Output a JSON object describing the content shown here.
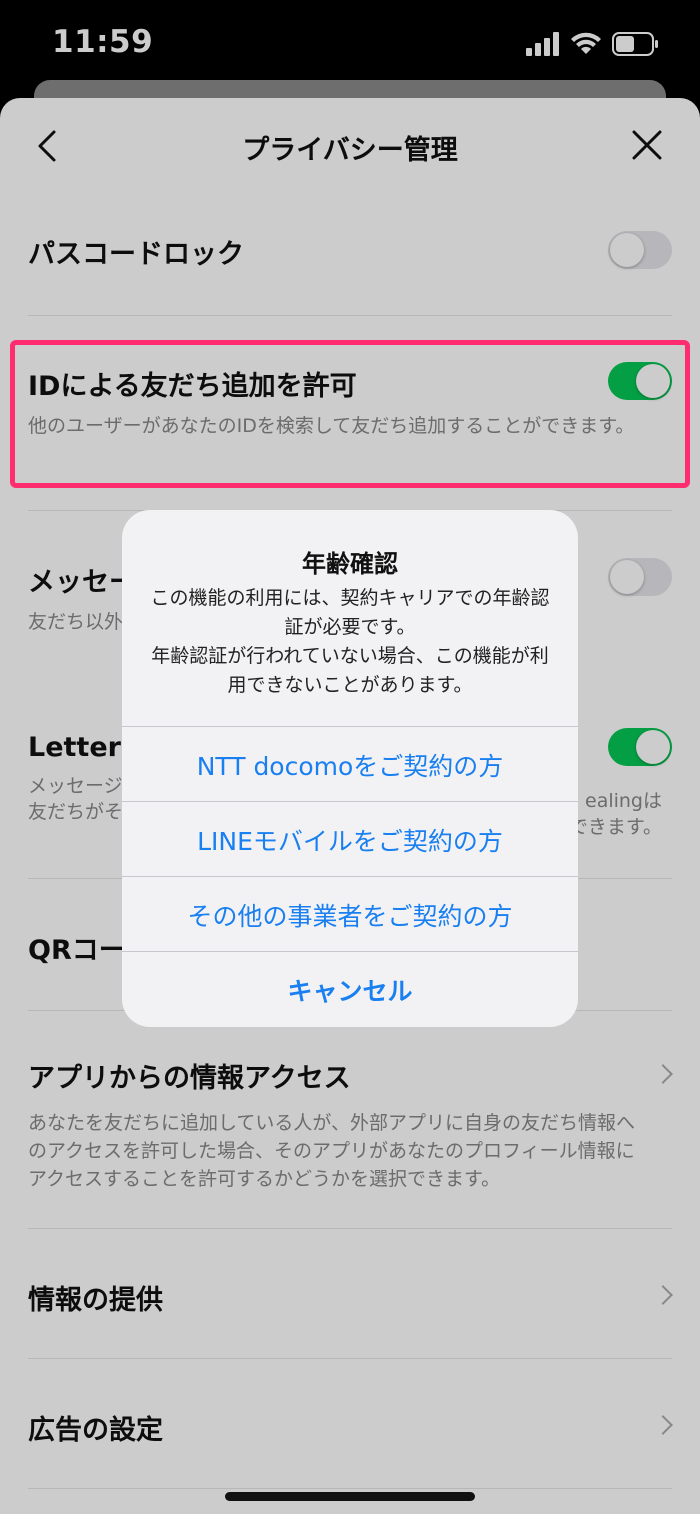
{
  "status": {
    "time": "11:59"
  },
  "nav": {
    "title": "プライバシー管理"
  },
  "settings": {
    "passcode": {
      "label": "パスコードロック",
      "enabled": false
    },
    "add_by_id": {
      "label": "IDによる友だち追加を許可",
      "desc": "他のユーザーがあなたのIDを検索して友だち追加することができます。",
      "enabled": true
    },
    "message_filter": {
      "label_visible": "メッセー",
      "desc_visible": "友だち以外",
      "enabled": false
    },
    "letter_sealing": {
      "label_visible": "Letter S",
      "desc_line1_left": "メッセージ",
      "desc_line1_right": "ealingは",
      "desc_line2_left": "友だちがそ",
      "desc_line2_right": "できます。",
      "enabled": true
    },
    "qr_code": {
      "label_visible": "QRコー"
    },
    "app_access": {
      "label": "アプリからの情報アクセス",
      "desc": "あなたを友だちに追加している人が、外部アプリに自身の友だち情報へのアクセスを許可した場合、そのアプリがあなたのプロフィール情報にアクセスすることを許可するかどうかを選択できます。"
    },
    "info_provision": {
      "label": "情報の提供"
    },
    "ad_settings": {
      "label": "広告の設定"
    }
  },
  "alert": {
    "title": "年齢確認",
    "message": "この機能の利用には、契約キャリアでの年齢認証が必要です。\n年齢認証が行われていない場合、この機能が利用できないことがあります。",
    "buttons": {
      "docomo": "NTT docomoをご契約の方",
      "line_mobile": "LINEモバイルをご契約の方",
      "other": "その他の事業者をご契約の方",
      "cancel": "キャンセル"
    }
  },
  "colors": {
    "toggle_on": "#06c755",
    "highlight": "#ff2d6f",
    "alert_button": "#1a7ff0"
  }
}
